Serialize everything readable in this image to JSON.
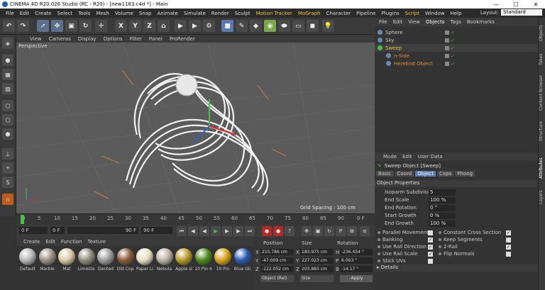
{
  "window": {
    "title": "CINEMA 4D R20.026 Studio (RC - R20) - [new1183.c4d *] - Main",
    "min": "—",
    "max": "☐",
    "close": "✕"
  },
  "menu": [
    "File",
    "Edit",
    "Create",
    "Select",
    "Tools",
    "Mesh",
    "Volume",
    "Snap",
    "Animate",
    "Simulate",
    "Render",
    "Sculpt",
    "Motion Tracker",
    "MoGraph",
    "Character",
    "Pipeline",
    "Plugins",
    "Script",
    "Window",
    "Help"
  ],
  "layout": {
    "label": "Layout:",
    "value": "Standard"
  },
  "toolbar": {
    "x_label": "X",
    "y_label": "Y",
    "z_label": "Z"
  },
  "viewport": {
    "menu": [
      "View",
      "Cameras",
      "Display",
      "Options",
      "Filter",
      "Panel",
      "ProRender"
    ],
    "camera_label": "Perspective",
    "grid_spacing": "Grid Spacing : 100 cm"
  },
  "timeline": {
    "ticks": [
      "0",
      "5",
      "10",
      "15",
      "20",
      "25",
      "30",
      "35",
      "40",
      "45",
      "50",
      "55",
      "60",
      "65",
      "70",
      "75",
      "80",
      "85",
      "90"
    ],
    "end_label": "0 F"
  },
  "playback": {
    "current": "0 F",
    "start": "0 F",
    "end_field": "90 F",
    "end": "90 F"
  },
  "materials": {
    "menu": [
      "Create",
      "Edit",
      "Function",
      "Texture"
    ],
    "items": [
      {
        "name": "Default",
        "color": "#b5b5b5"
      },
      {
        "name": "Marble",
        "color": "#9a8f84"
      },
      {
        "name": "Mat",
        "color": "#d9c9a3"
      },
      {
        "name": "Limesto",
        "color": "#8c8c7c"
      },
      {
        "name": "Dented",
        "color": "#9b9b9b"
      },
      {
        "name": "Old Cop",
        "color": "#8a5a3a"
      },
      {
        "name": "Paper Li",
        "color": "#e6dcc0"
      },
      {
        "name": "Nebula",
        "color": "#b9b0a2"
      },
      {
        "name": "Apple sl",
        "color": "#b59a2a"
      },
      {
        "name": "10 Pin 4",
        "color": "#4d8a1a"
      },
      {
        "name": "10 Pin",
        "color": "#d7a21a"
      },
      {
        "name": "Blue Gli",
        "color": "#2a5ab0"
      }
    ]
  },
  "coords": {
    "headers": [
      "Position",
      "Size",
      "Rotation"
    ],
    "rows": [
      {
        "axis": "X",
        "pos": "215.786 cm",
        "size_axis": "X",
        "size": "183.975 cm",
        "rot_axis": "H",
        "rot": "-236.454 °"
      },
      {
        "axis": "Y",
        "pos": "-47.009 cm",
        "size_axis": "Y",
        "size": "227.023 cm",
        "rot_axis": "P",
        "rot": "6.063 °"
      },
      {
        "axis": "Z",
        "pos": "-122.052 cm",
        "size_axis": "Z",
        "size": "203.883 cm",
        "rot_axis": "B",
        "rot": "-14.17 °"
      }
    ],
    "mode": "Object (Rel)",
    "size_mode": "Size",
    "apply": "Apply"
  },
  "objects": {
    "tabs": [
      "File",
      "Edit",
      "View",
      "Objects",
      "Tags",
      "Bookmarks"
    ],
    "rows": [
      {
        "name": "Sphere",
        "color": "#c8c8c8"
      },
      {
        "name": "Sky",
        "color": "#c8c8c8"
      },
      {
        "name": "Sweep",
        "color": "#f0c040"
      },
      {
        "name": "n-Side",
        "color": "#e08a3a"
      },
      {
        "name": "HereEnd Object",
        "color": "#e08a3a"
      }
    ]
  },
  "attributes": {
    "menu": [
      "Mode",
      "Edit",
      "User Data"
    ],
    "object_title": "Sweep Object [Sweep]",
    "tabs": [
      "Basic",
      "Coord",
      "Object",
      "Caps",
      "Phong"
    ],
    "section": "Object Properties",
    "fields": [
      {
        "label": "Isoparm Subdivision",
        "value": "5"
      },
      {
        "label": "End Scale",
        "value": "100 %"
      },
      {
        "label": "End Rotation",
        "value": "0 °"
      },
      {
        "label": "Start Growth",
        "value": "0 %"
      },
      {
        "label": "End Growth",
        "value": "100 %"
      }
    ],
    "checks_left": [
      {
        "label": "Parallel Movement",
        "checked": ""
      },
      {
        "label": "Banking",
        "checked": "✓"
      },
      {
        "label": "Use Rail Direction",
        "checked": "✓"
      },
      {
        "label": "Use Rail Scale",
        "checked": "✓"
      },
      {
        "label": "Stick UVs",
        "checked": ""
      }
    ],
    "checks_right": [
      {
        "label": "Constant Cross Section",
        "checked": "✓"
      },
      {
        "label": "Keep Segments",
        "checked": ""
      },
      {
        "label": "2-Rail",
        "checked": "✓"
      },
      {
        "label": "Flip Normals",
        "checked": ""
      }
    ],
    "details": "Details"
  },
  "side_tabs": [
    "Objects",
    "Takes",
    "Content Browser",
    "Structure",
    "Attributes",
    "Layers"
  ]
}
